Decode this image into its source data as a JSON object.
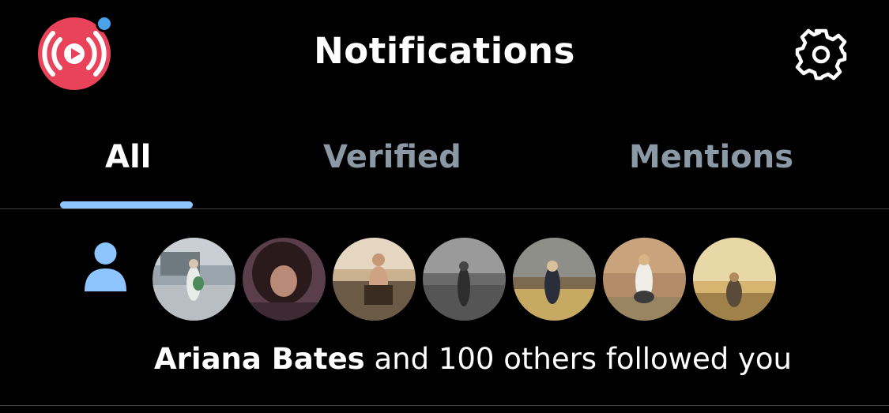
{
  "header": {
    "title": "Notifications",
    "logo_icon": "broadcast-play-icon",
    "settings_icon": "gear-icon"
  },
  "tabs": [
    {
      "label": "All",
      "active": true
    },
    {
      "label": "Verified",
      "active": false
    },
    {
      "label": "Mentions",
      "active": false
    }
  ],
  "notification": {
    "type_icon": "person-icon",
    "actor_name": "Ariana Bates",
    "message": " and 100 others followed you",
    "avatars": [
      {
        "name": "avatar-1"
      },
      {
        "name": "avatar-2"
      },
      {
        "name": "avatar-3"
      },
      {
        "name": "avatar-4"
      },
      {
        "name": "avatar-5"
      },
      {
        "name": "avatar-6"
      },
      {
        "name": "avatar-7"
      }
    ]
  },
  "colors": {
    "background": "#000000",
    "accent": "#8ec5ff",
    "inactive_tab": "#8b98a5",
    "logo_red": "#e8435a",
    "badge_blue": "#4aa3e8"
  }
}
